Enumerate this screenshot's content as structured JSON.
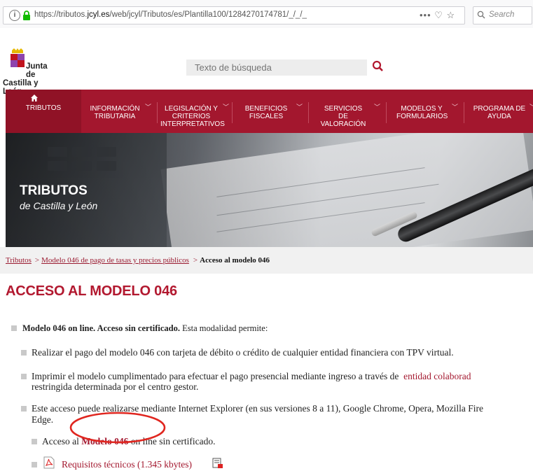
{
  "browser": {
    "url_prefix": "https://tributos.",
    "url_domain": "jcyl.es",
    "url_path": "/web/jcyl/Tributos/es/Plantilla100/1284270174781/_/_/_",
    "actions": "••• ♡ ☆",
    "search_placeholder": "Search"
  },
  "site": {
    "logo_line1": "Junta de",
    "logo_line2": "Castilla y León",
    "search_placeholder": "Texto de búsqueda"
  },
  "nav": {
    "items": [
      {
        "label": "TRIBUTOS"
      },
      {
        "label": "INFORMACIÓN TRIBUTARIA"
      },
      {
        "label": "LEGISLACIÓN Y CRITERIOS INTERPRETATIVOS"
      },
      {
        "label": "BENEFICIOS FISCALES"
      },
      {
        "label": "SERVICIOS DE VALORACIÓN"
      },
      {
        "label": "MODELOS Y FORMULARIOS"
      },
      {
        "label": "PROGRAMA DE AYUDA"
      }
    ]
  },
  "hero": {
    "title": "TRIBUTOS",
    "subtitle": "de Castilla y León"
  },
  "breadcrumb": {
    "item1": "Tributos",
    "sep": ">",
    "item2": "Modelo 046 de pago de tasas y precios públicos",
    "current": "Acceso al modelo 046"
  },
  "main": {
    "title": "ACCESO AL MODELO 046",
    "intro_bold": "Modelo 046 on line. Acceso sin certificado.",
    "intro_rest": " Esta modalidad permite:",
    "item1": "Realizar el pago del modelo 046 con tarjeta de débito o crédito de cualquier entidad financiera con TPV virtual.",
    "item2_a": "Imprimir el modelo cumplimentado para efectuar el pago presencial mediante ingreso a través de",
    "item2_link": "entidad colaborad",
    "item2_b": "restringida determinada por el centro gestor.",
    "item3_a": "Este acceso puede realizarse mediante Internet Explorer (en sus versiones 8 a 11), Google Chrome, Opera, Mozilla Fire",
    "item3_b": "Edge.",
    "access_pre": "Acceso al ",
    "access_link": "Modelo 046",
    "access_post": " on line sin certificado.",
    "req_link": "Requisitos técnicos (1.345 kbytes)"
  },
  "colors": {
    "brand_red": "#a3172e",
    "annotation_red": "#e0261f"
  }
}
